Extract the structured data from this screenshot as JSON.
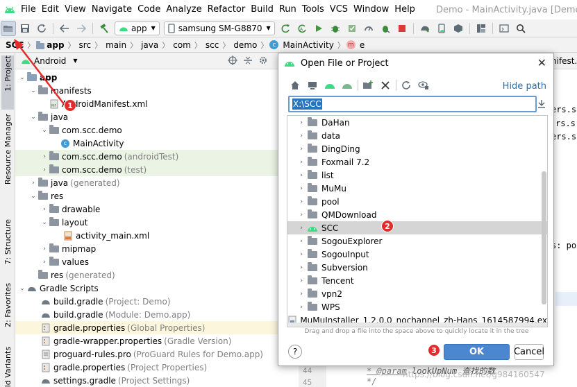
{
  "window": {
    "title": "Demo - MainActivity.java [Demo.app]"
  },
  "menu": {
    "items": [
      {
        "label": "File"
      },
      {
        "label": "Edit"
      },
      {
        "label": "View"
      },
      {
        "label": "Navigate"
      },
      {
        "label": "Code"
      },
      {
        "label": "Analyze"
      },
      {
        "label": "Refactor"
      },
      {
        "label": "Build"
      },
      {
        "label": "Run"
      },
      {
        "label": "Tools"
      },
      {
        "label": "VCS"
      },
      {
        "label": "Window"
      },
      {
        "label": "Help"
      }
    ]
  },
  "toolbar": {
    "run_config": "app",
    "device": "samsung SM-G8870"
  },
  "breadcrumb": {
    "items": [
      "SCC",
      "app",
      "src",
      "main",
      "java",
      "com",
      "scc",
      "demo",
      "MainActivity",
      "e"
    ]
  },
  "left_strip": {
    "tabs": [
      "1: Project",
      "Resource Manager",
      "7: Structure",
      "2: Favorites",
      "Build Variants"
    ]
  },
  "project_panel": {
    "view_mode": "Android",
    "tree": [
      {
        "label": "app",
        "hint": "",
        "icon": "app-module-icon"
      },
      {
        "label": "manifests",
        "hint": "",
        "icon": "folder-icon"
      },
      {
        "label": "AndroidManifest.xml",
        "hint": "",
        "icon": "manifest-file-icon"
      },
      {
        "label": "java",
        "hint": "",
        "icon": "folder-icon"
      },
      {
        "label": "com.scc.demo",
        "hint": "",
        "icon": "package-icon"
      },
      {
        "label": "MainActivity",
        "hint": "",
        "icon": "class-icon"
      },
      {
        "label": "com.scc.demo",
        "hint": "(androidTest)",
        "icon": "package-icon"
      },
      {
        "label": "com.scc.demo",
        "hint": "(test)",
        "icon": "package-icon"
      },
      {
        "label": "java",
        "hint": "(generated)",
        "icon": "folder-icon"
      },
      {
        "label": "res",
        "hint": "",
        "icon": "folder-icon"
      },
      {
        "label": "drawable",
        "hint": "",
        "icon": "folder-icon"
      },
      {
        "label": "layout",
        "hint": "",
        "icon": "folder-icon"
      },
      {
        "label": "activity_main.xml",
        "hint": "",
        "icon": "layout-file-icon"
      },
      {
        "label": "mipmap",
        "hint": "",
        "icon": "folder-icon"
      },
      {
        "label": "values",
        "hint": "",
        "icon": "folder-icon"
      },
      {
        "label": "res",
        "hint": "(generated)",
        "icon": "folder-icon"
      },
      {
        "label": "Gradle Scripts",
        "hint": "",
        "icon": "gradle-icon"
      },
      {
        "label": "build.gradle",
        "hint": "(Project: Demo)",
        "icon": "gradle-icon"
      },
      {
        "label": "build.gradle",
        "hint": "(Module: Demo.app)",
        "icon": "gradle-icon"
      },
      {
        "label": "gradle.properties",
        "hint": "(Global Properties)",
        "icon": "properties-icon"
      },
      {
        "label": "gradle-wrapper.properties",
        "hint": "(Gradle Version)",
        "icon": "properties-icon"
      },
      {
        "label": "proguard-rules.pro",
        "hint": "(ProGuard Rules for Demo.app)",
        "icon": "proguard-icon"
      },
      {
        "label": "gradle.properties",
        "hint": "(Project Properties)",
        "icon": "properties-icon"
      },
      {
        "label": "settings.gradle",
        "hint": "(Project Settings)",
        "icon": "gradle-icon"
      }
    ]
  },
  "editor": {
    "tab_fragment": "nifest.x",
    "fragments": [
      "ers.s",
      "rs.s",
      "ers.s",
      "s: pos"
    ],
    "line_numbers": [
      "44",
      "45"
    ],
    "code_line_44_tag": "* @param",
    "code_line_44_rest": "lookUpNum 查找的数",
    "code_line_45": "*/"
  },
  "dialog": {
    "title": "Open File or Project",
    "hide_path": "Hide path",
    "path_value": "X:\\SCC",
    "items": [
      {
        "label": "DaHan",
        "type": "folder"
      },
      {
        "label": "data",
        "type": "folder"
      },
      {
        "label": "DingDing",
        "type": "folder"
      },
      {
        "label": "Foxmail 7.2",
        "type": "folder"
      },
      {
        "label": "list",
        "type": "folder"
      },
      {
        "label": "MuMu",
        "type": "folder"
      },
      {
        "label": "pool",
        "type": "folder"
      },
      {
        "label": "QMDownload",
        "type": "folder"
      },
      {
        "label": "SCC",
        "type": "android-project"
      },
      {
        "label": "SogouExplorer",
        "type": "folder"
      },
      {
        "label": "SogouInput",
        "type": "folder"
      },
      {
        "label": "Subversion",
        "type": "folder"
      },
      {
        "label": "Tencent",
        "type": "folder"
      },
      {
        "label": "vpn2",
        "type": "folder"
      },
      {
        "label": "WPS",
        "type": "folder"
      },
      {
        "label": "MuMuInstaller_1.2.0.0_nochannel_zh-Hans_1614587994.ex",
        "type": "file"
      }
    ],
    "selected_item": "SCC",
    "drop_hint": "Drag and drop a file into the space above to quickly locate it in the tree",
    "help_label": "?",
    "ok_label": "OK",
    "cancel_label": "Cancel"
  },
  "annotations": {
    "badge_1": "1",
    "badge_2": "2",
    "badge_3": "3"
  },
  "watermark": "https://blog.csdn.net/g984160547",
  "colors": {
    "accent_blue": "#4a87d0",
    "selection_blue": "#2675bf",
    "android_green": "#3ddc84",
    "annotation_red": "#e52a2a",
    "link_blue": "#2470b3"
  }
}
